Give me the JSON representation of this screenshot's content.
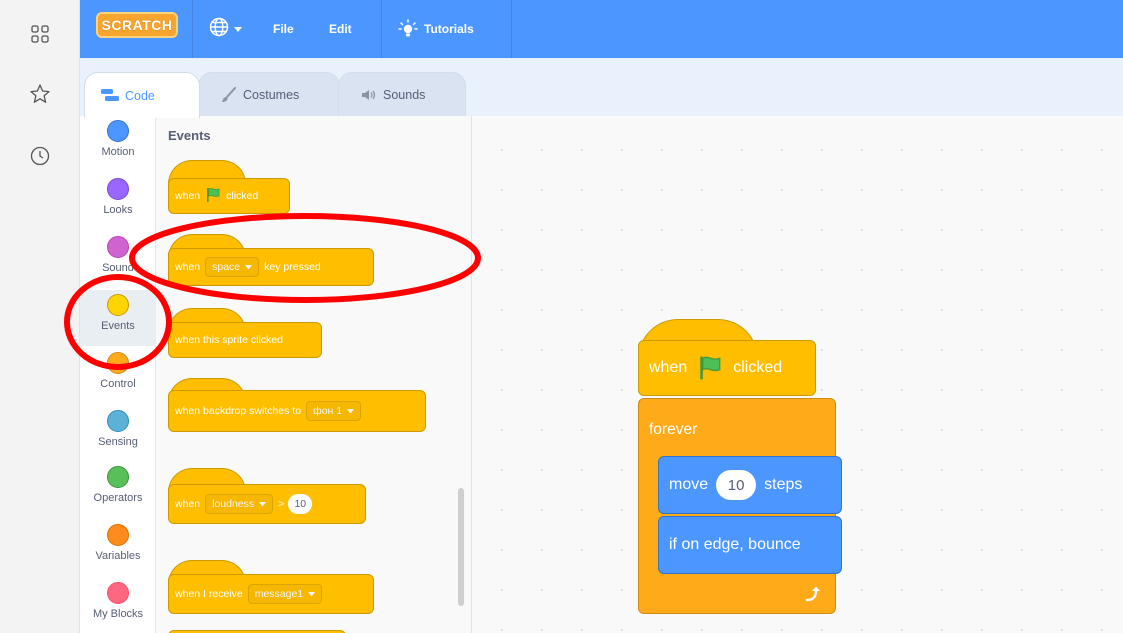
{
  "browser_rail": {
    "icons": [
      "apps-grid-icon",
      "favorites-star-icon",
      "history-clock-icon"
    ]
  },
  "menubar": {
    "logo_text": "SCRATCH",
    "file_label": "File",
    "edit_label": "Edit",
    "tutorials_label": "Tutorials"
  },
  "tabs": {
    "code_label": "Code",
    "costumes_label": "Costumes",
    "sounds_label": "Sounds"
  },
  "categories": [
    {
      "label": "Motion",
      "color": "#4c97ff"
    },
    {
      "label": "Looks",
      "color": "#9966ff"
    },
    {
      "label": "Sound",
      "color": "#cf63cf"
    },
    {
      "label": "Events",
      "color": "#ffd500"
    },
    {
      "label": "Control",
      "color": "#ffab19"
    },
    {
      "label": "Sensing",
      "color": "#5cb1d6"
    },
    {
      "label": "Operators",
      "color": "#59c059"
    },
    {
      "label": "Variables",
      "color": "#ff8c1a"
    },
    {
      "label": "My Blocks",
      "color": "#ff6680"
    }
  ],
  "palette": {
    "title": "Events",
    "flag_block": {
      "when": "when",
      "clicked": "clicked"
    },
    "key_block": {
      "when": "when",
      "key": "space",
      "suffix": "key pressed"
    },
    "sprite_block": {
      "label": "when this sprite clicked"
    },
    "backdrop_block": {
      "label": "when backdrop switches to",
      "value": "фон 1"
    },
    "loudness_block": {
      "when": "when",
      "sensor": "loudness",
      "op": ">",
      "value": "10"
    },
    "receive_block": {
      "label": "when I receive",
      "value": "message1"
    }
  },
  "script": {
    "hat_when": "when",
    "hat_clicked": "clicked",
    "forever_label": "forever",
    "move_label": "move",
    "move_steps": "10",
    "steps_label": "steps",
    "bounce_label": "if on edge, bounce"
  },
  "colors": {
    "menubar": "#4c97ff",
    "events": "#ffbf00",
    "control": "#ffab19",
    "motion": "#4c97ff",
    "annotation": "#ff0000"
  }
}
